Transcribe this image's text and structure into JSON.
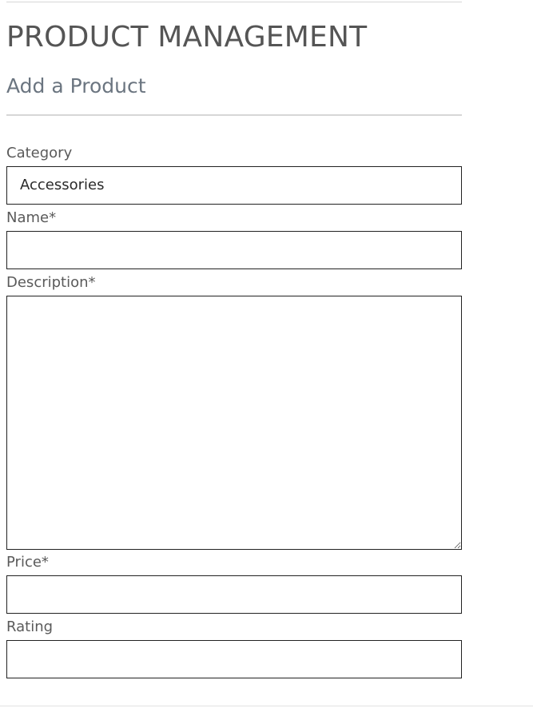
{
  "header": {
    "title": "PRODUCT MANAGEMENT",
    "subtitle": "Add a Product"
  },
  "form": {
    "category": {
      "label": "Category",
      "value": "Accessories"
    },
    "name": {
      "label": "Name*",
      "value": ""
    },
    "description": {
      "label": "Description*",
      "value": ""
    },
    "price": {
      "label": "Price*",
      "value": ""
    },
    "rating": {
      "label": "Rating",
      "value": ""
    }
  },
  "colors": {
    "title": "#555555",
    "subtitle": "#6b7580",
    "label": "#5a5a5a",
    "input_border": "#222222",
    "divider": "#d6d6d6"
  }
}
